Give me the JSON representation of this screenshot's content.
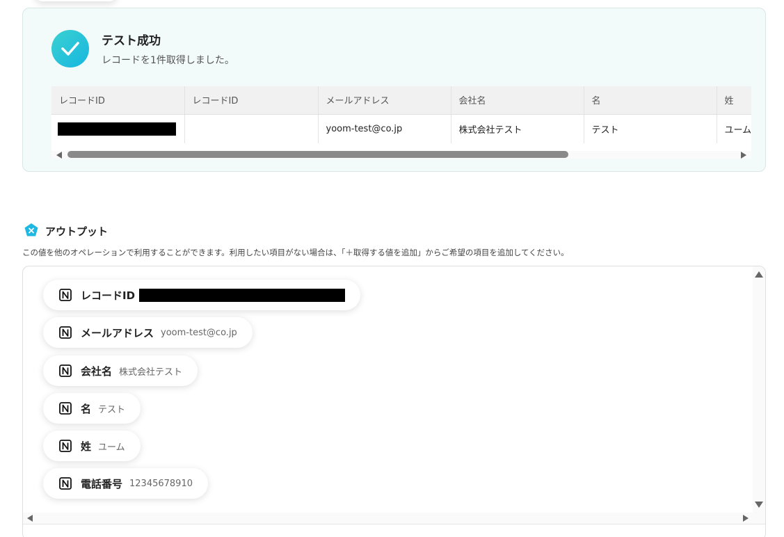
{
  "result": {
    "title": "テスト成功",
    "subtitle": "レコードを1件取得しました。"
  },
  "table": {
    "headers": [
      "レコードID",
      "レコードID",
      "メールアドレス",
      "会社名",
      "名",
      "姓"
    ],
    "row": [
      "",
      "",
      "yoom-test@co.jp",
      "株式会社テスト",
      "テスト",
      "ユーム"
    ]
  },
  "output": {
    "title": "アウトプット",
    "description": "この値を他のオペレーションで利用することができます。利用したい項目がない場合は、「＋取得する値を追加」からご希望の項目を追加してください。",
    "items": [
      {
        "label": "レコードID",
        "value": ""
      },
      {
        "label": "メールアドレス",
        "value": "yoom-test@co.jp"
      },
      {
        "label": "会社名",
        "value": "株式会社テスト"
      },
      {
        "label": "名",
        "value": "テスト"
      },
      {
        "label": "姓",
        "value": "ユーム"
      },
      {
        "label": "電話番号",
        "value": "12345678910"
      }
    ]
  },
  "colors": {
    "accent": "#17b6e0",
    "card_bg": "#f3fafa"
  },
  "icons": {
    "success": "checkmark-icon",
    "output": "variable-x-icon",
    "item": "notion-icon"
  }
}
